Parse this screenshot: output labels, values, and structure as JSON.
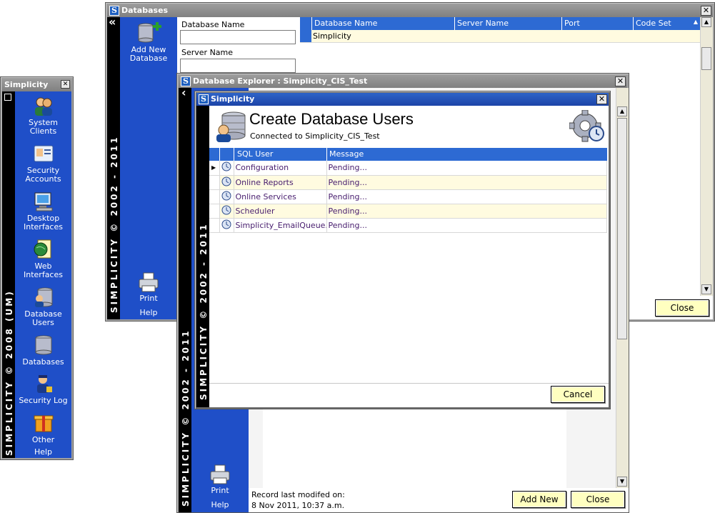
{
  "sidebar_window": {
    "title": "Simplicity",
    "close_glyph": "✕",
    "vertical_text": "SIMPLICITY © 2008 (UM)",
    "items": [
      {
        "label": "System\nClients",
        "icon": "system-clients-icon"
      },
      {
        "label": "Security\nAccounts",
        "icon": "security-accounts-icon"
      },
      {
        "label": "Desktop\nInterfaces",
        "icon": "desktop-interfaces-icon"
      },
      {
        "label": "Web\nInterfaces",
        "icon": "web-interfaces-icon"
      },
      {
        "label": "Database\nUsers",
        "icon": "database-users-icon"
      },
      {
        "label": "Databases",
        "icon": "databases-icon"
      },
      {
        "label": "Security Log",
        "icon": "security-log-icon"
      },
      {
        "label": "Other",
        "icon": "other-icon"
      }
    ],
    "help": "Help"
  },
  "databases_window": {
    "title": "Databases",
    "close_glyph": "✕",
    "collapse_glyph": "«",
    "vertical_text": "SIMPLICITY © 2002 - 2011",
    "add_new_label": "Add New\nDatabase",
    "print_label": "Print",
    "help": "Help",
    "filter_labels": {
      "database_name": "Database Name",
      "server_name": "Server Name"
    },
    "grid_columns": [
      "Database Name",
      "Server Name",
      "Port",
      "Code Set"
    ],
    "sort_glyph": "▲",
    "rows": [
      {
        "database_name": "Simplicity",
        "server_name": "",
        "port": "",
        "code_set": ""
      }
    ],
    "close_button": "Close"
  },
  "explorer_window": {
    "title": "Database Explorer : Simplicity_CIS_Test",
    "close_glyph": "✕",
    "collapse_glyph": "‹",
    "vertical_text": "SIMPLICITY © 2002 - 2011",
    "print_label": "Print",
    "help": "Help",
    "record_modified_label": "Record last modifed on:",
    "record_modified_value": "8 Nov 2011, 10:37 a.m.",
    "add_new_button": "Add New",
    "close_button": "Close"
  },
  "dialog": {
    "title": "Simplicity",
    "close_glyph": "✕",
    "vertical_text": "SIMPLICITY © 2002 - 2011",
    "heading": "Create Database Users",
    "subheading": "Connected to Simplicity_CIS_Test",
    "columns": [
      "SQL User",
      "Message"
    ],
    "rows": [
      {
        "user": "Configuration",
        "message": "Pending..."
      },
      {
        "user": "Online Reports",
        "message": "Pending..."
      },
      {
        "user": "Online Services",
        "message": "Pending..."
      },
      {
        "user": "Scheduler",
        "message": "Pending..."
      },
      {
        "user": "Simplicity_EmailQueue...",
        "message": "Pending..."
      }
    ],
    "cancel_button": "Cancel"
  },
  "colors": {
    "nav_blue": "#1f4fc8",
    "title_active": "#1c44a8",
    "button_yellow": "#ffffc0",
    "row_alt": "#fffbe0",
    "grid_header": "#2d6ad3"
  }
}
